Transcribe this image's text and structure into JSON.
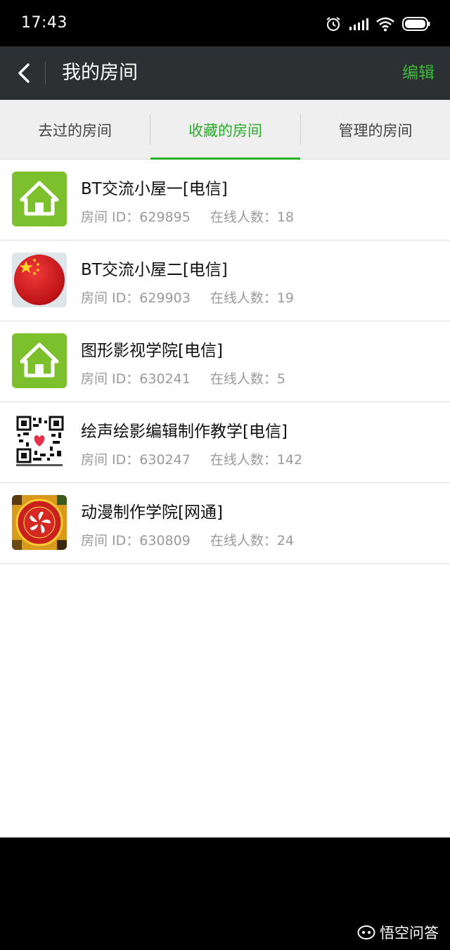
{
  "status_bar": {
    "time": "17:43"
  },
  "header": {
    "title": "我的房间",
    "edit_label": "编辑"
  },
  "tabs": [
    {
      "label": "去过的房间",
      "active": false
    },
    {
      "label": "收藏的房间",
      "active": true
    },
    {
      "label": "管理的房间",
      "active": false
    }
  ],
  "rooms": [
    {
      "name": "BT交流小屋一[电信]",
      "id": "房间 ID：629895",
      "online": "在线人数：18",
      "avatar": "house-icon"
    },
    {
      "name": "BT交流小屋二[电信]",
      "id": "房间 ID：629903",
      "online": "在线人数：19",
      "avatar": "china-flag-avatar"
    },
    {
      "name": "图形影视学院[电信]",
      "id": "房间 ID：630241",
      "online": "在线人数：5",
      "avatar": "house-icon"
    },
    {
      "name": "绘声绘影编辑制作教学[电信]",
      "id": "房间 ID：630247",
      "online": "在线人数：142",
      "avatar": "qr-code-avatar"
    },
    {
      "name": "动漫制作学院[网通]",
      "id": "房间 ID：630809",
      "online": "在线人数：24",
      "avatar": "bauhinia-emblem-avatar"
    }
  ],
  "watermark": "悟空问答",
  "colors": {
    "accent_green": "#2bb02b",
    "titlebar": "#2d3032",
    "house_tile": "#7cc12d"
  }
}
